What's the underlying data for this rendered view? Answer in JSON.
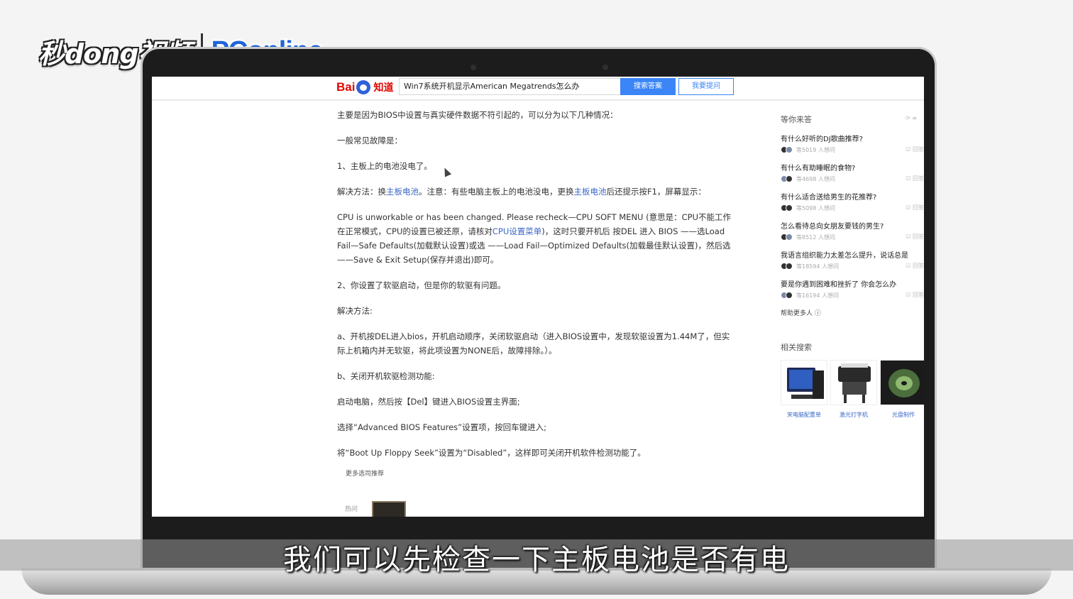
{
  "watermark": {
    "cn_text": "秒dong视频",
    "brand_text": "PConline"
  },
  "search": {
    "query": "Win7系统开机显示American Megatrends怎么办",
    "search_button": "搜索答案",
    "ask_button": "我要提问",
    "logo_text": "Bai",
    "logo_suffix": "知道"
  },
  "answer": {
    "p1": "主要是因为BIOS中设置与真实硬件数据不符引起的，可以分为以下几种情况：",
    "p2": "一般常见故障是：",
    "p3": "1、主板上的电池没电了。",
    "p4a": "解决方法：换",
    "p4_link1": "主板电池",
    "p4b": "。注意：有些电脑主板上的电池没电，更换",
    "p4_link2": "主板电池",
    "p4c": "后还提示按F1，屏幕显示：",
    "p5a": "CPU is unworkable or has been changed. Please recheck—CPU SOFT MENU (意思是：CPU不能工作在正常模式，CPU的设置已被还原，请核对",
    "p5_link": "CPU设置菜单",
    "p5b": ")，这时只要开机后 按DEL 进入 BIOS ——选Load Fail—Safe Defaults(加载默认设置)或选 ——Load Fail—Optimized Defaults(加载最佳默认设置)，然后选——Save & Exit Setup(保存并退出)即可。",
    "p6": "2、你设置了软驱启动，但是你的软驱有问题。",
    "p7": "解决方法:",
    "p8": "a、开机按DEL进入bios，开机启动顺序，关闭软驱启动（进入BIOS设置中，发现软驱设置为1.44M了，但实际上机箱内并无软驱，将此项设置为NONE后，故障排除。）。",
    "p9": "b、关闭开机软驱检测功能:",
    "p10": "启动电脑，然后按【Del】键进入BIOS设置主界面;",
    "p11": "选择“Advanced BIOS Features”设置项，按回车键进入;",
    "p12": "将“Boot Up Floppy Seek”设置为“Disabled”，这样即可关闭开机软件检测功能了。",
    "more_related": "更多选司推荐",
    "bottom_label": "热问"
  },
  "sidebar": {
    "head": "等你来答",
    "head_icons": "⟳ ≡",
    "questions": [
      {
        "title": "有什么好听的DJ歌曲推荐?",
        "count": "等5019 人想问",
        "action": "☑ 回答"
      },
      {
        "title": "有什么有助睡眠的食物?",
        "count": "等4698 人想问",
        "action": "☑ 回答"
      },
      {
        "title": "有什么适合送给男生的花推荐?",
        "count": "等5098 人想问",
        "action": "☑ 回答"
      },
      {
        "title": "怎么看待总向女朋友要钱的男生?",
        "count": "等8512 人想问",
        "action": "☑ 回答"
      },
      {
        "title": "我语言组织能力太差怎么提升，说话总是",
        "count": "等18594 人想问",
        "action": "☑ 回答"
      },
      {
        "title": "要是你遇到困难和挫折了 你会怎么办",
        "count": "等16194 人想问",
        "action": "☑ 回答"
      }
    ],
    "help_more": "帮助更多人 ⓘ",
    "related_head": "相关搜索",
    "related": [
      {
        "caption": "宋电脑配置单"
      },
      {
        "caption": "激光打字机"
      },
      {
        "caption": "光盘制作"
      }
    ]
  },
  "subtitle": "我们可以先检查一下主板电池是否有电",
  "colors": {
    "accent": "#3b85f7",
    "baidu_red": "#e10601",
    "link": "#3a67c7"
  }
}
